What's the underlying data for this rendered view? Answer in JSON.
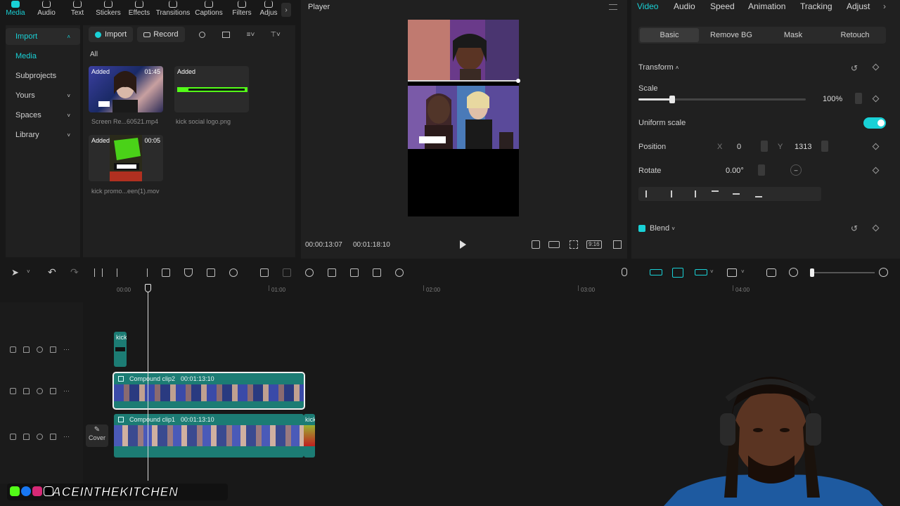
{
  "media_tabs": [
    "Media",
    "Audio",
    "Text",
    "Stickers",
    "Effects",
    "Transitions",
    "Captions",
    "Filters",
    "Adjus"
  ],
  "sidebar": {
    "import_label": "Import",
    "items": [
      {
        "label": "Media",
        "has_chevron": false
      },
      {
        "label": "Subprojects",
        "has_chevron": false
      },
      {
        "label": "Yours",
        "has_chevron": true
      },
      {
        "label": "Spaces",
        "has_chevron": true
      },
      {
        "label": "Library",
        "has_chevron": true
      }
    ]
  },
  "media": {
    "import_button": "Import",
    "record_button": "Record",
    "filter_all": "All",
    "items": [
      {
        "tag": "Added",
        "duration": "01:45",
        "name": "Screen Re...60521.mp4"
      },
      {
        "tag": "Added",
        "duration": "",
        "name": "kick social logo.png"
      },
      {
        "tag": "Added",
        "duration": "00:05",
        "name": "kick promo...een(1).mov"
      }
    ]
  },
  "player": {
    "title": "Player",
    "current_time": "00:00:13:07",
    "total_time": "00:01:18:10",
    "ratio_label": "9:16"
  },
  "properties": {
    "tabs": [
      "Video",
      "Audio",
      "Speed",
      "Animation",
      "Tracking",
      "Adjust"
    ],
    "active_tab": "Video",
    "subtabs": [
      "Basic",
      "Remove BG",
      "Mask",
      "Retouch"
    ],
    "active_subtab": "Basic",
    "transform_label": "Transform",
    "scale_label": "Scale",
    "scale_value": "100%",
    "scale_fraction": 0.2,
    "uniform_scale_label": "Uniform scale",
    "position_label": "Position",
    "position_x_label": "X",
    "position_x": "0",
    "position_y_label": "Y",
    "position_y": "1313",
    "rotate_label": "Rotate",
    "rotate_value": "0.00°",
    "blend_label": "Blend"
  },
  "timeline": {
    "ruler_labels": [
      "00:00",
      "01:00",
      "02:00",
      "03:00",
      "04:00"
    ],
    "cover_label": "Cover",
    "clips": [
      {
        "label": "kick"
      },
      {
        "label": "Compound clip2",
        "duration": "00:01:13:10"
      },
      {
        "label": "Compound clip1",
        "duration": "00:01:13:10"
      },
      {
        "label": "kick"
      }
    ]
  },
  "overlay": {
    "banner_text": "ACEINTHEKITCHEN"
  },
  "colors": {
    "accent": "#19d1d6",
    "clip": "#1c7c74",
    "panel": "#202020"
  }
}
